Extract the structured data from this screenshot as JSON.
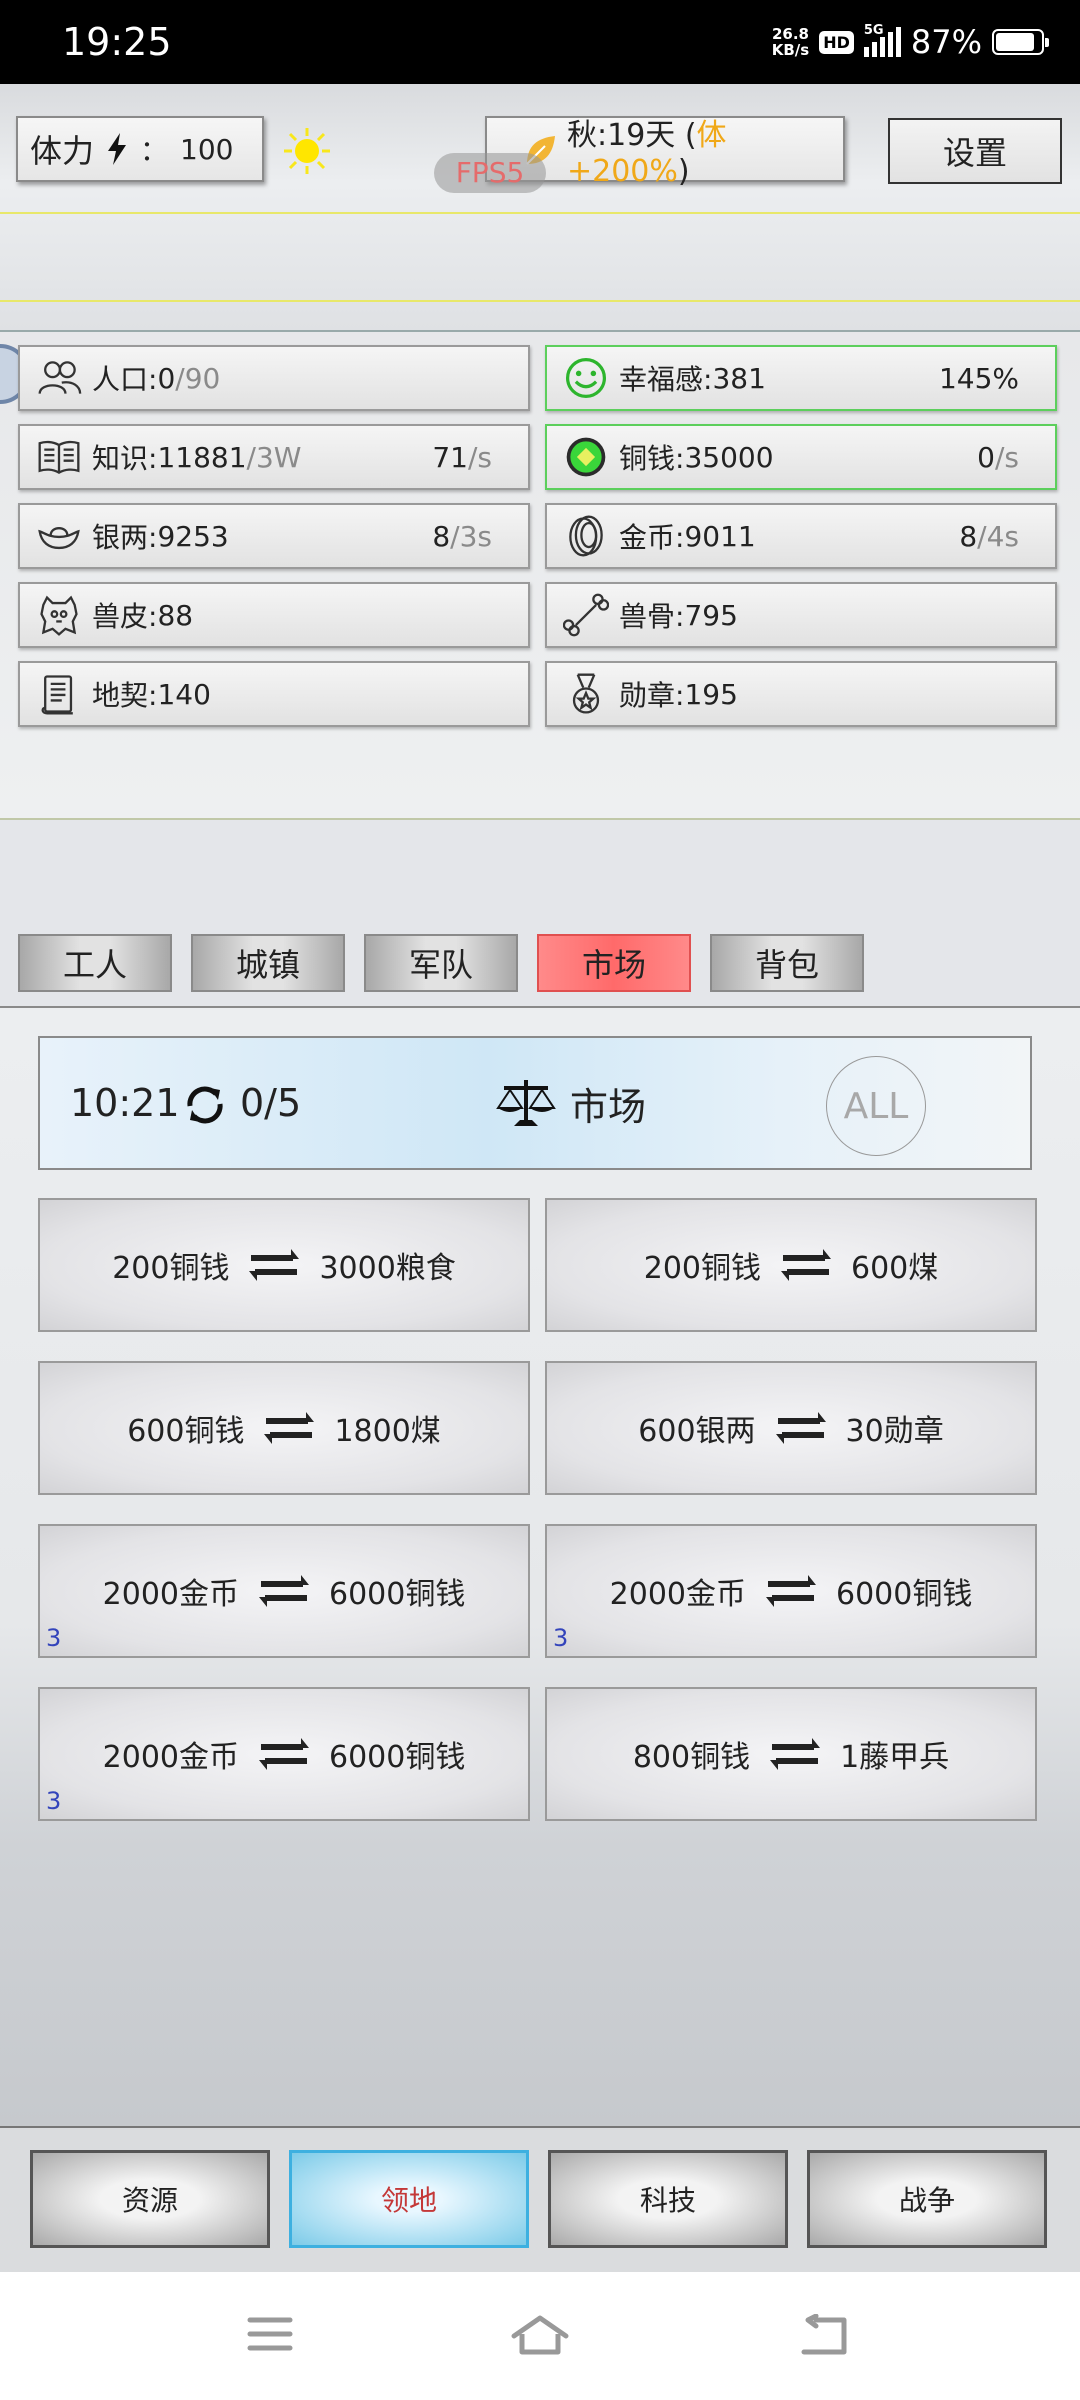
{
  "status_bar": {
    "time": "19:25",
    "net_speed_value": "26.8",
    "net_speed_unit": "KB/s",
    "hd_label": "HD",
    "network_type": "5G",
    "battery": "87%",
    "battery_level": 0.87
  },
  "top": {
    "stamina_label": "体力",
    "stamina_sep": "：",
    "stamina_value": "100",
    "fps_label": "FPS5",
    "season_text": "秋:19天 (",
    "season_bonus": "体+200%",
    "season_close": ")",
    "settings_label": "设置"
  },
  "resources": [
    {
      "icon": "people-icon",
      "label": "人口:",
      "value": "0",
      "max": "/90",
      "rate": "",
      "rate_unit": ""
    },
    {
      "icon": "smile-icon",
      "label": "幸福感:",
      "value": "381",
      "max": "",
      "rate": "145%",
      "rate_unit": ""
    },
    {
      "icon": "book-icon",
      "label": "知识:",
      "value": "11881",
      "max": "/3W",
      "rate": "71",
      "rate_unit": "/s"
    },
    {
      "icon": "copper-coin-icon",
      "label": "铜钱:",
      "value": "35000",
      "max": "",
      "rate": "0",
      "rate_unit": "/s"
    },
    {
      "icon": "silver-ingot-icon",
      "label": "银两:",
      "value": "9253",
      "max": "",
      "rate": "8",
      "rate_unit": "/3s"
    },
    {
      "icon": "gold-coin-icon",
      "label": "金币:",
      "value": "9011",
      "max": "",
      "rate": "8",
      "rate_unit": "/4s"
    },
    {
      "icon": "hide-icon",
      "label": "兽皮:",
      "value": "88",
      "max": "",
      "rate": "",
      "rate_unit": ""
    },
    {
      "icon": "bone-icon",
      "label": "兽骨:",
      "value": "795",
      "max": "",
      "rate": "",
      "rate_unit": ""
    },
    {
      "icon": "deed-scroll-icon",
      "label": "地契:",
      "value": "140",
      "max": "",
      "rate": "",
      "rate_unit": ""
    },
    {
      "icon": "medal-icon",
      "label": "勋章:",
      "value": "195",
      "max": "",
      "rate": "",
      "rate_unit": ""
    }
  ],
  "tabs": [
    {
      "label": "工人"
    },
    {
      "label": "城镇"
    },
    {
      "label": "军队"
    },
    {
      "label": "市场",
      "active": true
    },
    {
      "label": "背包"
    }
  ],
  "market": {
    "timer": "10:21",
    "refresh_count": "0/5",
    "title": "市场",
    "all_label": "ALL",
    "trades": [
      {
        "give": "200铜钱",
        "get": "3000粮食",
        "count": ""
      },
      {
        "give": "200铜钱",
        "get": "600煤",
        "count": ""
      },
      {
        "give": "600铜钱",
        "get": "1800煤",
        "count": ""
      },
      {
        "give": "600银两",
        "get": "30勋章",
        "count": ""
      },
      {
        "give": "2000金币",
        "get": "6000铜钱",
        "count": "3"
      },
      {
        "give": "2000金币",
        "get": "6000铜钱",
        "count": "3"
      },
      {
        "give": "2000金币",
        "get": "6000铜钱",
        "count": "3"
      },
      {
        "give": "800铜钱",
        "get": "1藤甲兵",
        "count": ""
      }
    ]
  },
  "bottom_nav": [
    {
      "label": "资源"
    },
    {
      "label": "领地",
      "active": true
    },
    {
      "label": "科技"
    },
    {
      "label": "战争"
    }
  ],
  "colors": {
    "active_tab": "#ff6a6a",
    "active_nav": "#7ccbe8",
    "bonus_text": "#f0a818",
    "green_border": "#5ccf5c"
  }
}
